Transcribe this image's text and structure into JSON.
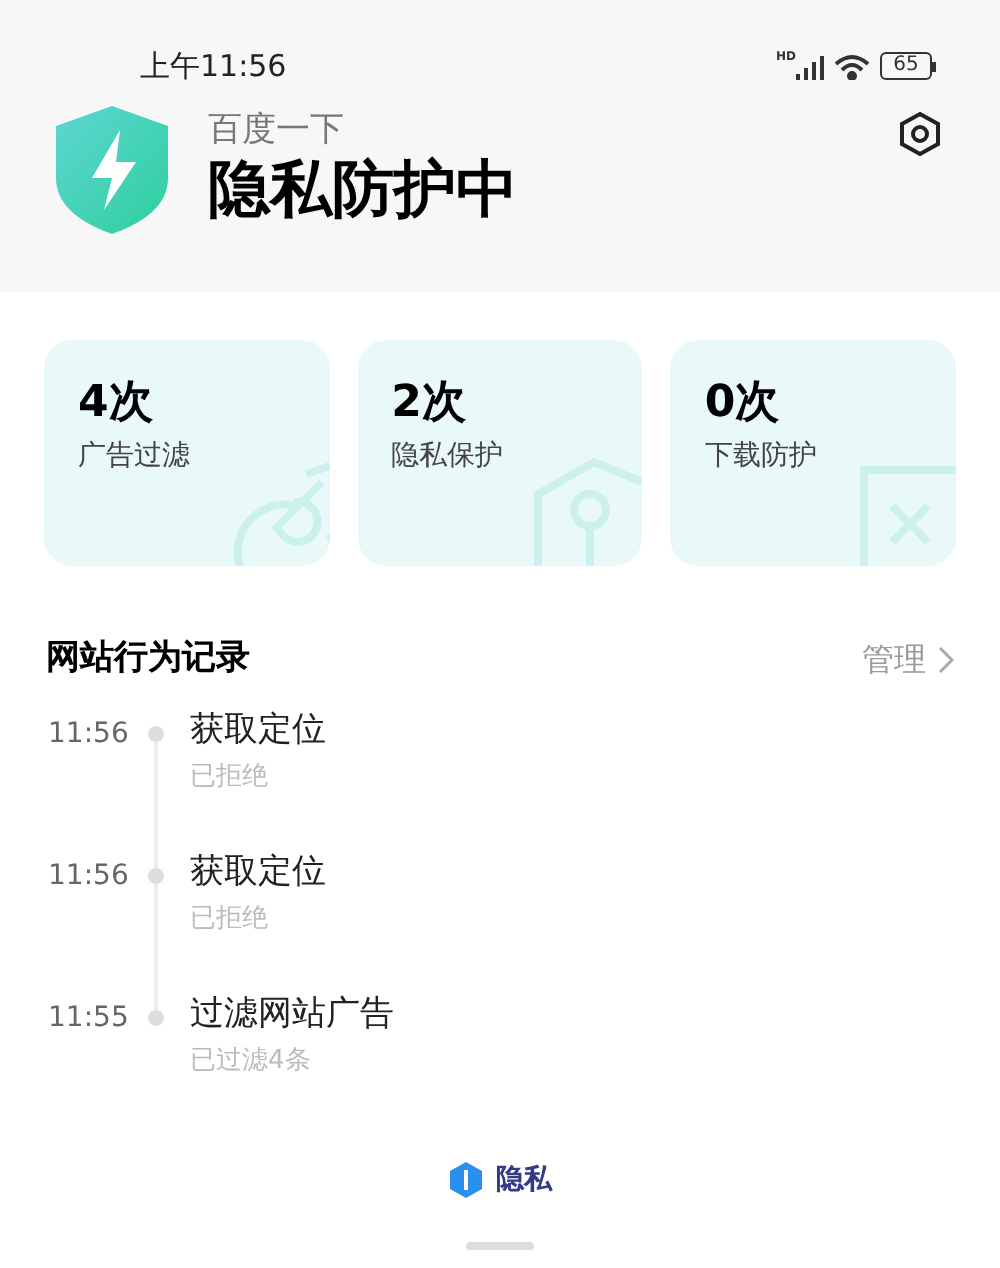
{
  "status_bar": {
    "time": "上午11:56",
    "network": "HD",
    "battery": "65"
  },
  "header": {
    "subtitle": "百度一下",
    "title": "隐私防护中"
  },
  "stats": [
    {
      "kind": "ads",
      "count": "4次",
      "label": "广告过滤"
    },
    {
      "kind": "privacy",
      "count": "2次",
      "label": "隐私保护"
    },
    {
      "kind": "download",
      "count": "0次",
      "label": "下载防护"
    }
  ],
  "records": {
    "title": "网站行为记录",
    "manage": "管理",
    "items": [
      {
        "time": "11:56",
        "title": "获取定位",
        "detail": "已拒绝"
      },
      {
        "time": "11:56",
        "title": "获取定位",
        "detail": "已拒绝"
      },
      {
        "time": "11:55",
        "title": "过滤网站广告",
        "detail": "已过滤4条"
      }
    ]
  },
  "footer": {
    "brand": "隐私"
  }
}
